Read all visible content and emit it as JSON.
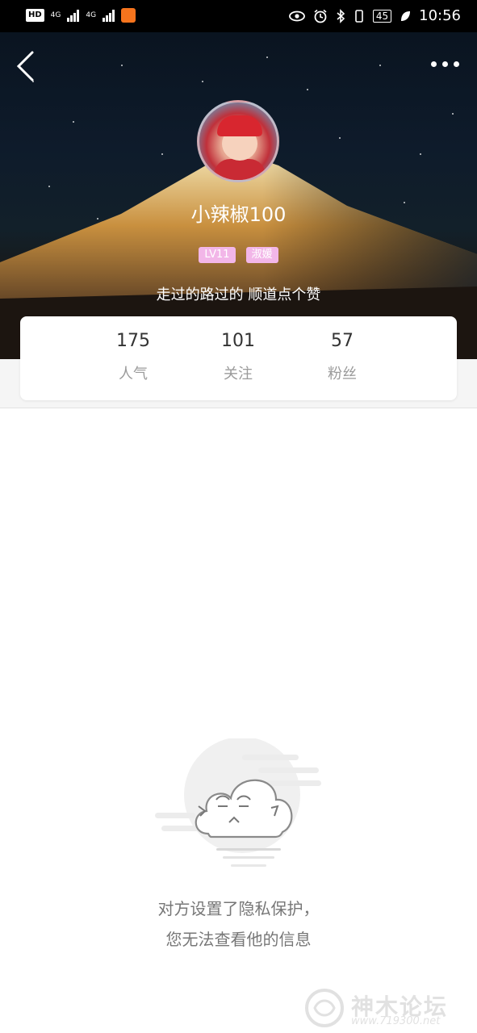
{
  "status_bar": {
    "hd_label": "HD",
    "network_1": "4G",
    "network_2": "4G",
    "battery": "45",
    "time": "10:56"
  },
  "profile": {
    "username": "小辣椒100",
    "tags": [
      "LV11",
      "淑媛"
    ],
    "bio": "走过的路过的 顺道点个赞"
  },
  "stats": [
    {
      "value": "175",
      "label": "人气"
    },
    {
      "value": "101",
      "label": "关注"
    },
    {
      "value": "57",
      "label": "粉丝"
    }
  ],
  "empty_state": {
    "line1": "对方设置了隐私保护，",
    "line2": "您无法查看他的信息"
  },
  "watermark": {
    "text": "神木论坛",
    "url": "www.719300.net"
  },
  "colors": {
    "tag_bg": "#f2b6e8",
    "stat_number": "#333333",
    "stat_label": "#9a9a9a",
    "message_text": "#777777"
  },
  "icons": [
    "back-arrow-icon",
    "more-dots-icon",
    "eye-icon",
    "alarm-icon",
    "bluetooth-icon",
    "battery-icon",
    "leaf-icon",
    "cloud-mascot-icon"
  ]
}
